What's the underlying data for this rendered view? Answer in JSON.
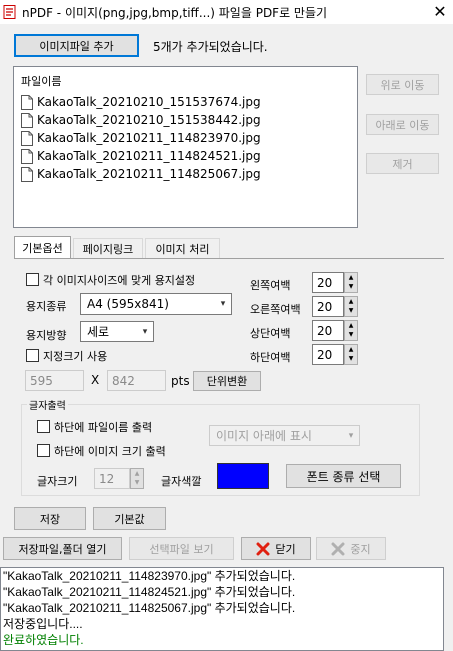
{
  "window": {
    "title": "nPDF - 이미지(png,jpg,bmp,tiff...) 파일을 PDF로 만들기",
    "close_glyph": "✕"
  },
  "top": {
    "add_image_button": "이미지파일 추가",
    "status": "5개가 추가되었습니다."
  },
  "file_list": {
    "header": "파일이름",
    "files": [
      "KakaoTalk_20210210_151537674.jpg",
      "KakaoTalk_20210210_151538442.jpg",
      "KakaoTalk_20210211_114823970.jpg",
      "KakaoTalk_20210211_114824521.jpg",
      "KakaoTalk_20210211_114825067.jpg"
    ]
  },
  "side_buttons": {
    "move_up": "위로 이동",
    "move_down": "아래로 이동",
    "remove": "제거"
  },
  "tabs": [
    "기본옵션",
    "페이지링크",
    "이미지 처리"
  ],
  "options": {
    "fit_paper_label": "각 이미지사이즈에 맞게 용지설정",
    "paper_type_label": "용지종류",
    "paper_type_value": "A4 (595x841)",
    "orientation_label": "용지방향",
    "orientation_value": "세로",
    "custom_size_label": "지정크기 사용",
    "width_value": "595",
    "x_label": "X",
    "height_value": "842",
    "unit_label": "pts",
    "unit_convert_button": "단위변환",
    "margins": [
      {
        "label": "왼쪽여백",
        "value": "20"
      },
      {
        "label": "오른쪽여백",
        "value": "20"
      },
      {
        "label": "상단여백",
        "value": "20"
      },
      {
        "label": "하단여백",
        "value": "20"
      }
    ]
  },
  "text_output": {
    "group_label": "글자출력",
    "print_filename_label": "하단에 파일이름 출력",
    "print_size_label": "하단에 이미지 크기 출력",
    "position_value": "이미지 아래에 표시",
    "font_size_label": "글자크기",
    "font_size_value": "12",
    "font_color_label": "글자색깔",
    "font_color": "#0000ff",
    "font_select_button": "폰트 종류 선택"
  },
  "actions": {
    "save_button": "저장",
    "default_button": "기본값",
    "open_save_folder_button": "저장파일,폴더 열기",
    "view_selected_button": "선택파일 보기",
    "close_button": "닫기",
    "stop_button": "중지"
  },
  "log": {
    "lines": [
      "\"KakaoTalk_20210211_114823970.jpg\" 추가되었습니다.",
      "\"KakaoTalk_20210211_114824521.jpg\" 추가되었습니다.",
      "\"KakaoTalk_20210211_114825067.jpg\" 추가되었습니다.",
      "저장중입니다....",
      "완료하였습니다."
    ],
    "success_color": "#008000"
  }
}
